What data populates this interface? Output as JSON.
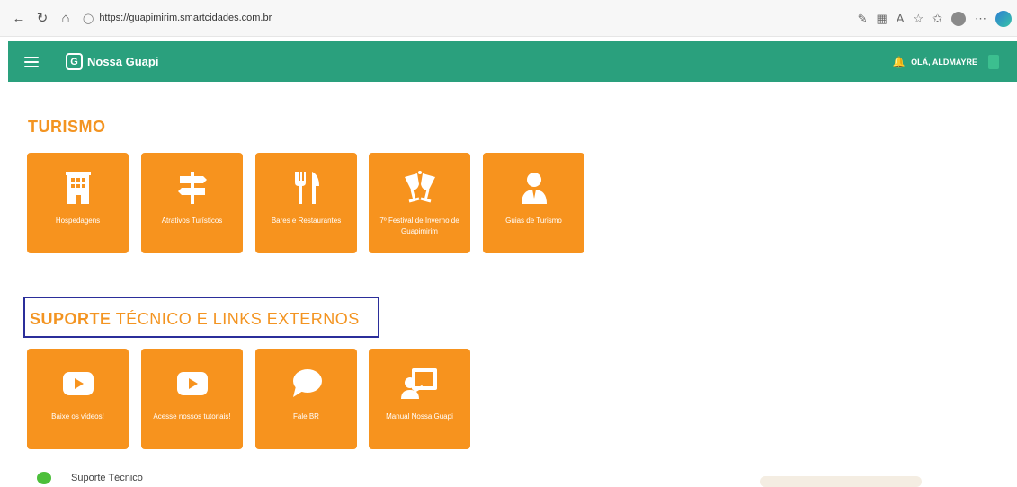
{
  "browser": {
    "url": "https://guapimirim.smartcidades.com.br"
  },
  "header": {
    "app_name": "Nossa Guapi",
    "logo_letter": "G",
    "greeting": "OLÁ, ALDMAYRE",
    "color": "#2aa07d"
  },
  "turismo": {
    "title": "TURISMO",
    "tiles": [
      {
        "label": "Hospedagens",
        "icon": "hotel-icon"
      },
      {
        "label": "Atrativos Turísticos",
        "icon": "signpost-icon"
      },
      {
        "label": "Bares e Restaurantes",
        "icon": "restaurant-icon"
      },
      {
        "label": "7º Festival de Inverno de Guapimirim",
        "icon": "toast-icon"
      },
      {
        "label": "Guias de Turismo",
        "icon": "guide-person-icon"
      }
    ]
  },
  "suporte": {
    "title_bold": "SUPORTE",
    "title_rest": " TÉCNICO E LINKS EXTERNOS",
    "tiles": [
      {
        "label": "Baixe os vídeos!",
        "icon": "youtube-icon"
      },
      {
        "label": "Acesse nossos tutoriais!",
        "icon": "youtube-icon"
      },
      {
        "label": "Fale BR",
        "icon": "chat-bubble-icon"
      },
      {
        "label": "Manual Nossa Guapi",
        "icon": "presentation-icon"
      }
    ],
    "item_label": "Suporte Técnico"
  },
  "accent_color": "#f7931e"
}
